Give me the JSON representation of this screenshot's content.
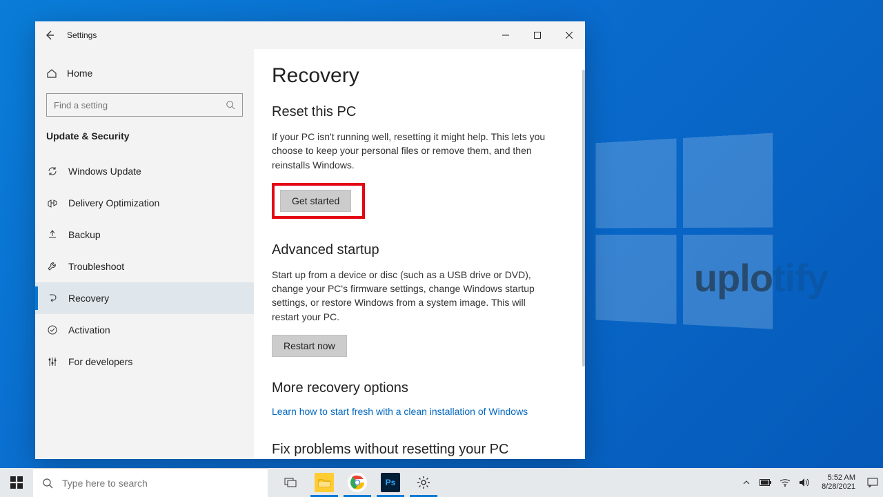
{
  "window": {
    "title": "Settings",
    "home_label": "Home",
    "search_placeholder": "Find a setting",
    "category": "Update & Security",
    "nav": [
      {
        "label": "Windows Update"
      },
      {
        "label": "Delivery Optimization"
      },
      {
        "label": "Backup"
      },
      {
        "label": "Troubleshoot"
      },
      {
        "label": "Recovery"
      },
      {
        "label": "Activation"
      },
      {
        "label": "For developers"
      }
    ]
  },
  "page": {
    "title": "Recovery",
    "reset": {
      "heading": "Reset this PC",
      "desc": "If your PC isn't running well, resetting it might help. This lets you choose to keep your personal files or remove them, and then reinstalls Windows.",
      "button": "Get started"
    },
    "advanced": {
      "heading": "Advanced startup",
      "desc": "Start up from a device or disc (such as a USB drive or DVD), change your PC's firmware settings, change Windows startup settings, or restore Windows from a system image. This will restart your PC.",
      "button": "Restart now"
    },
    "more": {
      "heading": "More recovery options",
      "link": "Learn how to start fresh with a clean installation of Windows"
    },
    "fix": {
      "heading": "Fix problems without resetting your PC"
    }
  },
  "taskbar": {
    "search_placeholder": "Type here to search",
    "clock_time": "5:52 AM",
    "clock_date": "8/28/2021"
  },
  "watermark": {
    "main": "uplo",
    "fade": "tify"
  }
}
